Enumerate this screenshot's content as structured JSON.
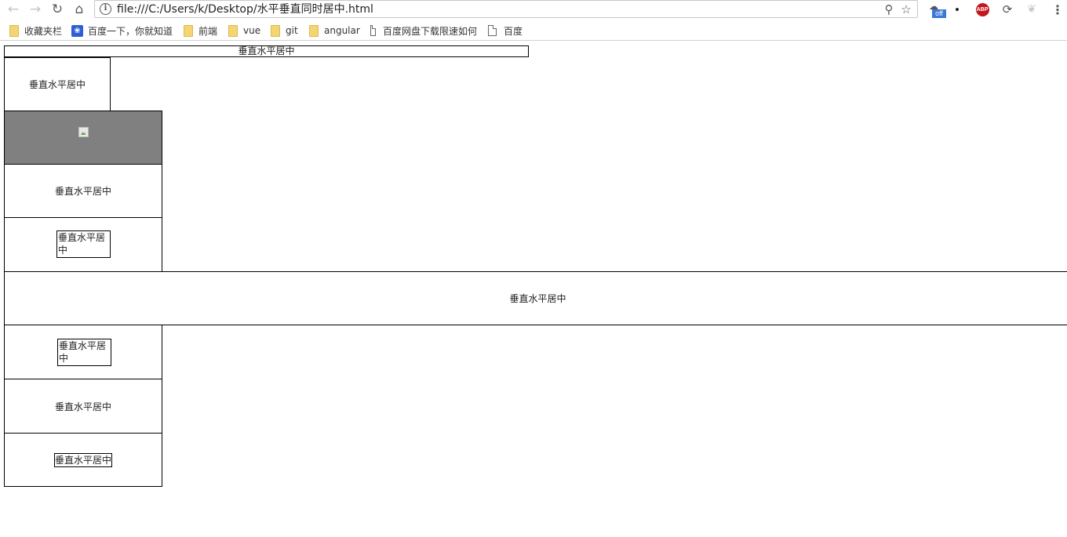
{
  "browser": {
    "nav": {
      "back_icon": "arrow-left-icon",
      "forward_icon": "arrow-right-icon",
      "reload_icon": "reload-icon",
      "home_icon": "home-icon"
    },
    "address_bar": {
      "info_icon": "info-icon",
      "url": "file:///C:/Users/k/Desktop/水平垂直同时居中.html",
      "zoom_icon": "zoom-icon",
      "star_icon": "star-icon"
    },
    "extensions": {
      "off_badge": "off",
      "abp_label": "ABP"
    },
    "bookmarks": [
      {
        "label": "收藏夹栏",
        "icon": "folder-icon"
      },
      {
        "label": "百度一下，你就知道",
        "icon": "baidu-paw-icon"
      },
      {
        "label": "前端",
        "icon": "folder-icon"
      },
      {
        "label": "vue",
        "icon": "folder-icon"
      },
      {
        "label": "git",
        "icon": "folder-icon"
      },
      {
        "label": "angular",
        "icon": "folder-icon"
      },
      {
        "label": "百度网盘下载限速如何",
        "icon": "page-icon"
      },
      {
        "label": "百度",
        "icon": "page-icon"
      }
    ]
  },
  "page": {
    "boxes": [
      {
        "text": "垂直水平居中"
      },
      {
        "text": "垂直水平居中"
      },
      {
        "image_icon": "broken-image-icon"
      },
      {
        "text": "垂直水平居中"
      },
      {
        "text": "垂直水平居中"
      },
      {
        "text": "垂直水平居中"
      },
      {
        "text": "垂直水平居中"
      },
      {
        "text": "垂直水平居中"
      },
      {
        "text": "垂直水平居中"
      }
    ]
  },
  "colors": {
    "gray_box": "#808080",
    "border": "#000000"
  }
}
